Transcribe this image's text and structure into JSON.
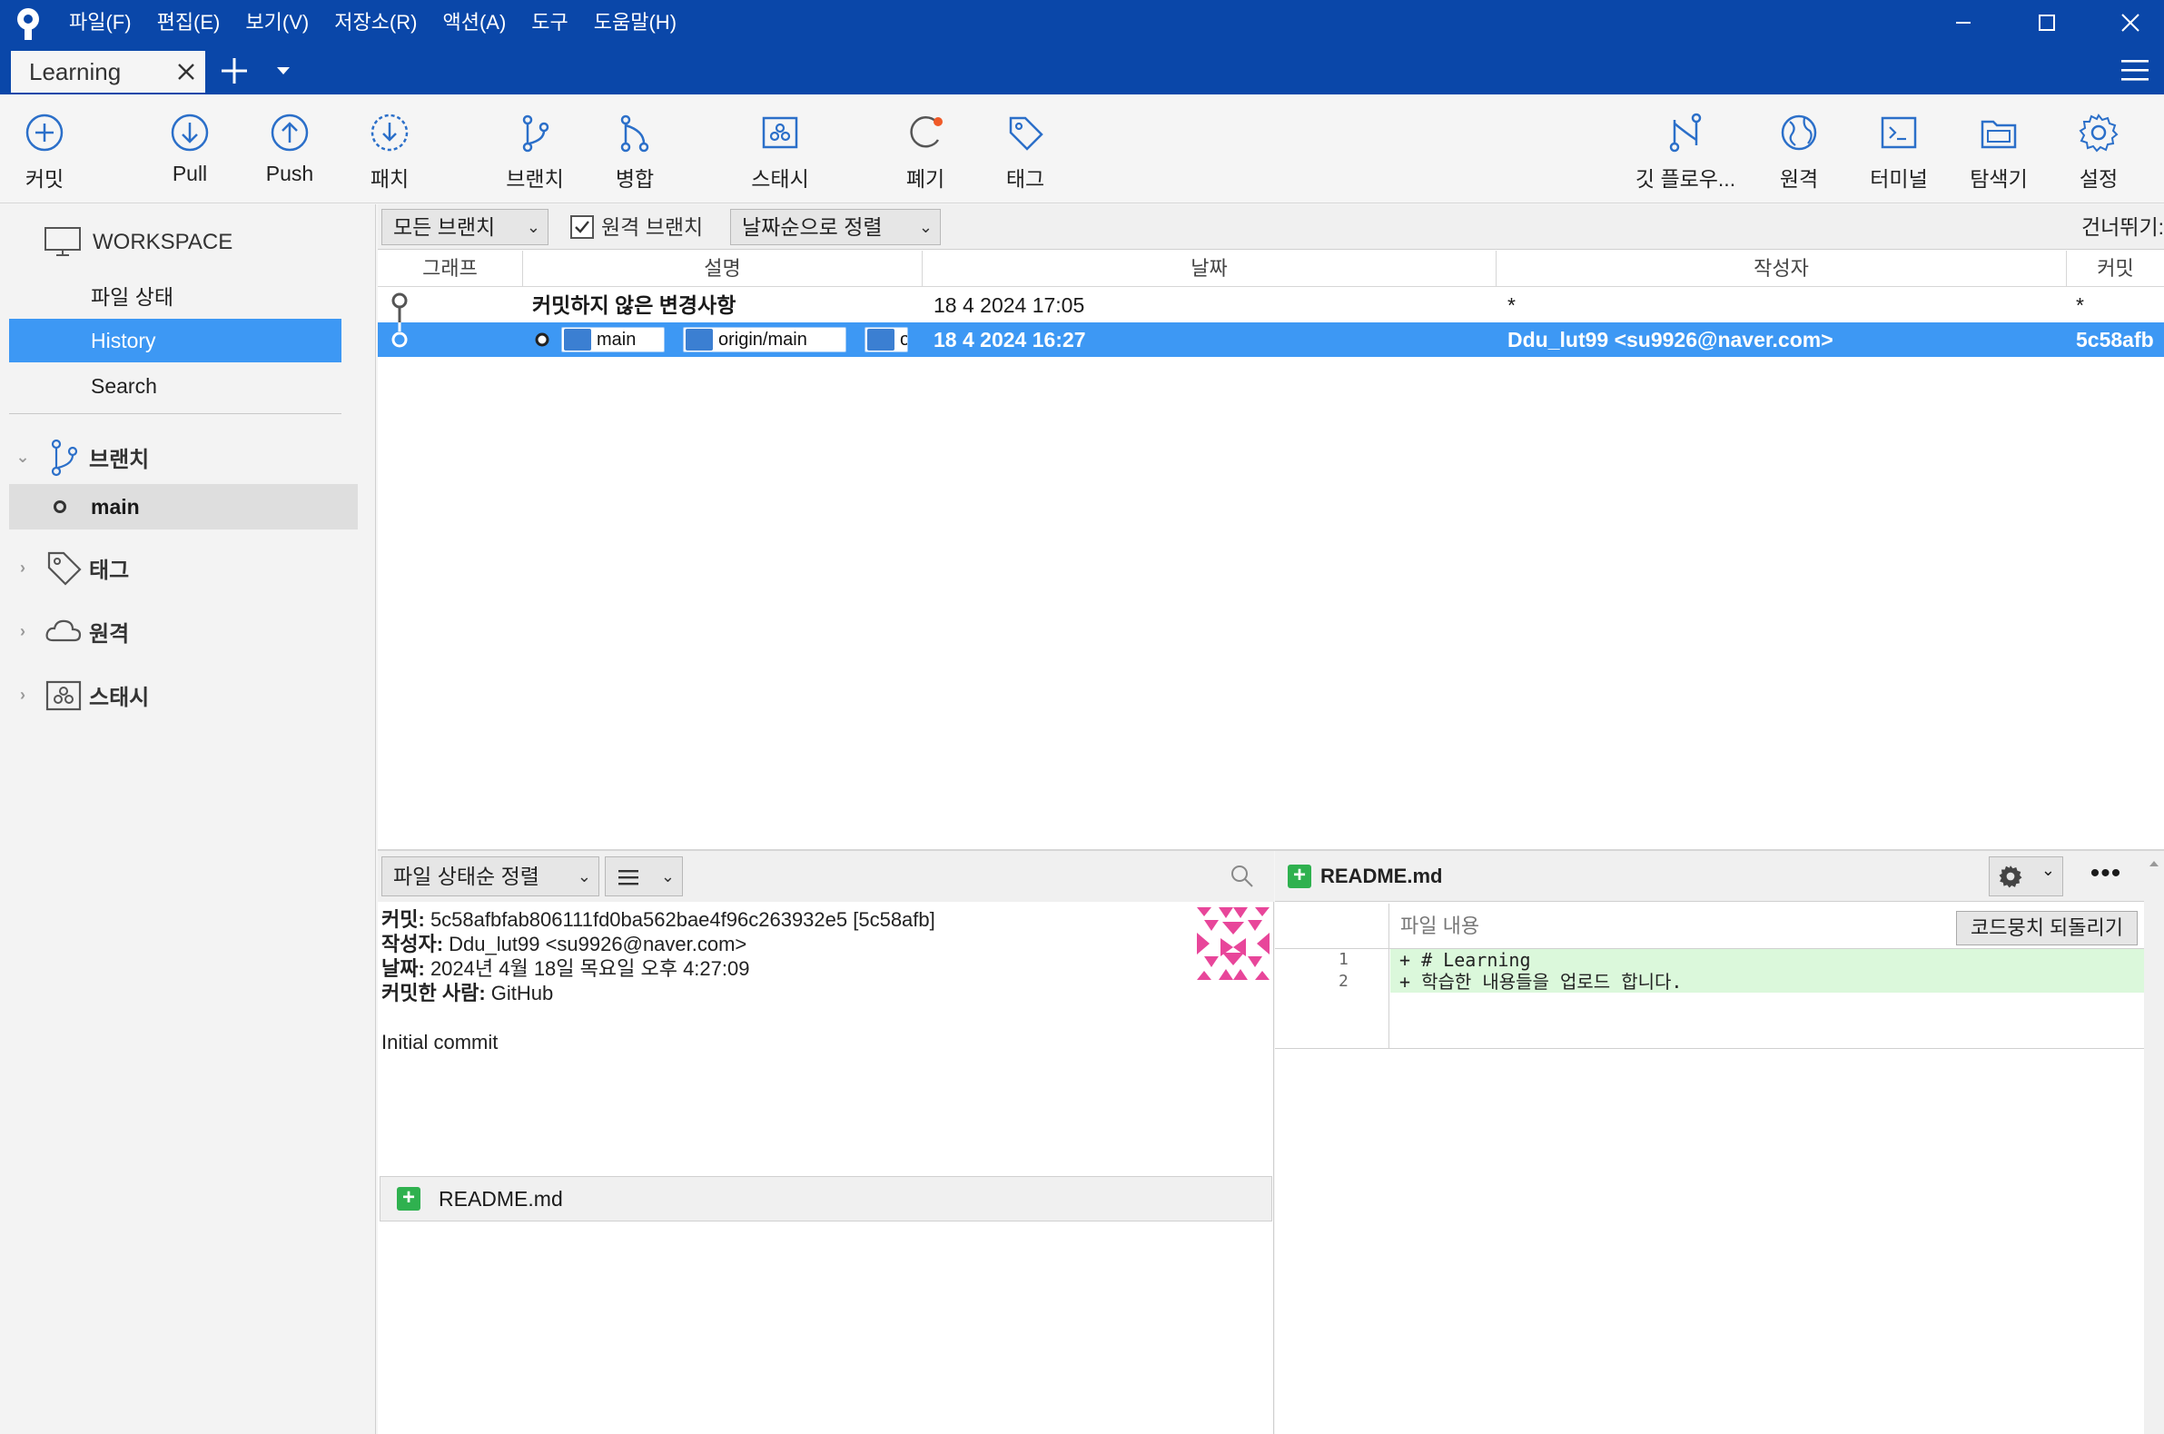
{
  "menu": [
    "파일(F)",
    "편집(E)",
    "보기(V)",
    "저장소(R)",
    "액션(A)",
    "도구",
    "도움말(H)"
  ],
  "tab": {
    "label": "Learning"
  },
  "toolbar": {
    "commit": "커밋",
    "pull": "Pull",
    "push": "Push",
    "patch": "패치",
    "branch": "브랜치",
    "merge": "병합",
    "stash": "스태시",
    "discard": "폐기",
    "tag": "태그",
    "gitflow": "깃 플로우...",
    "remote": "원격",
    "terminal": "터미널",
    "explorer": "탐색기",
    "settings": "설정"
  },
  "sidebar": {
    "workspace": "WORKSPACE",
    "items": [
      "파일 상태",
      "History",
      "Search"
    ],
    "branches_label": "브랜치",
    "branch_main": "main",
    "tags_label": "태그",
    "remotes_label": "원격",
    "stash_label": "스태시"
  },
  "filter": {
    "branches": "모든 브랜치",
    "remote_branches": "원격 브랜치",
    "remote_checked": true,
    "sort": "날짜순으로 정렬",
    "skip": "건너뛰기:"
  },
  "columns": [
    "그래프",
    "설명",
    "날짜",
    "작성자",
    "커밋"
  ],
  "commits": [
    {
      "desc": "커밋하지 않은 변경사항",
      "date": "18 4 2024 17:05",
      "author": "*",
      "hash": "*"
    },
    {
      "refs": [
        "main",
        "origin/main",
        "o"
      ],
      "date": "18 4 2024 16:27",
      "author": "Ddu_lut99 <su9926@naver.com>",
      "hash": "5c58afb"
    }
  ],
  "lower": {
    "sort": "파일 상태순 정렬",
    "commit_label": "커밋:",
    "commit_value": "5c58afbfab806111fd0ba562bae4f96c263932e5 [5c58afb]",
    "author_label": "작성자:",
    "author_value": "Ddu_lut99 <su9926@naver.com>",
    "date_label": "날짜:",
    "date_value": "2024년 4월 18일 목요일 오후 4:27:09",
    "committer_label": "커밋한 사람:",
    "committer_value": "GitHub",
    "message": "Initial commit",
    "file": "README.md"
  },
  "diff": {
    "file": "README.md",
    "content_label": "파일 내용",
    "revert": "코드뭉치 되돌리기",
    "lines": [
      {
        "n": "1",
        "text": "+ # Learning"
      },
      {
        "n": "2",
        "text": "+ 학습한 내용들을 업로드 합니다."
      }
    ]
  },
  "colors": {
    "titlebar": "#0a47a9",
    "selection": "#3d98f4",
    "added": "#dbf8db",
    "accent_orange": "#f05a28"
  }
}
